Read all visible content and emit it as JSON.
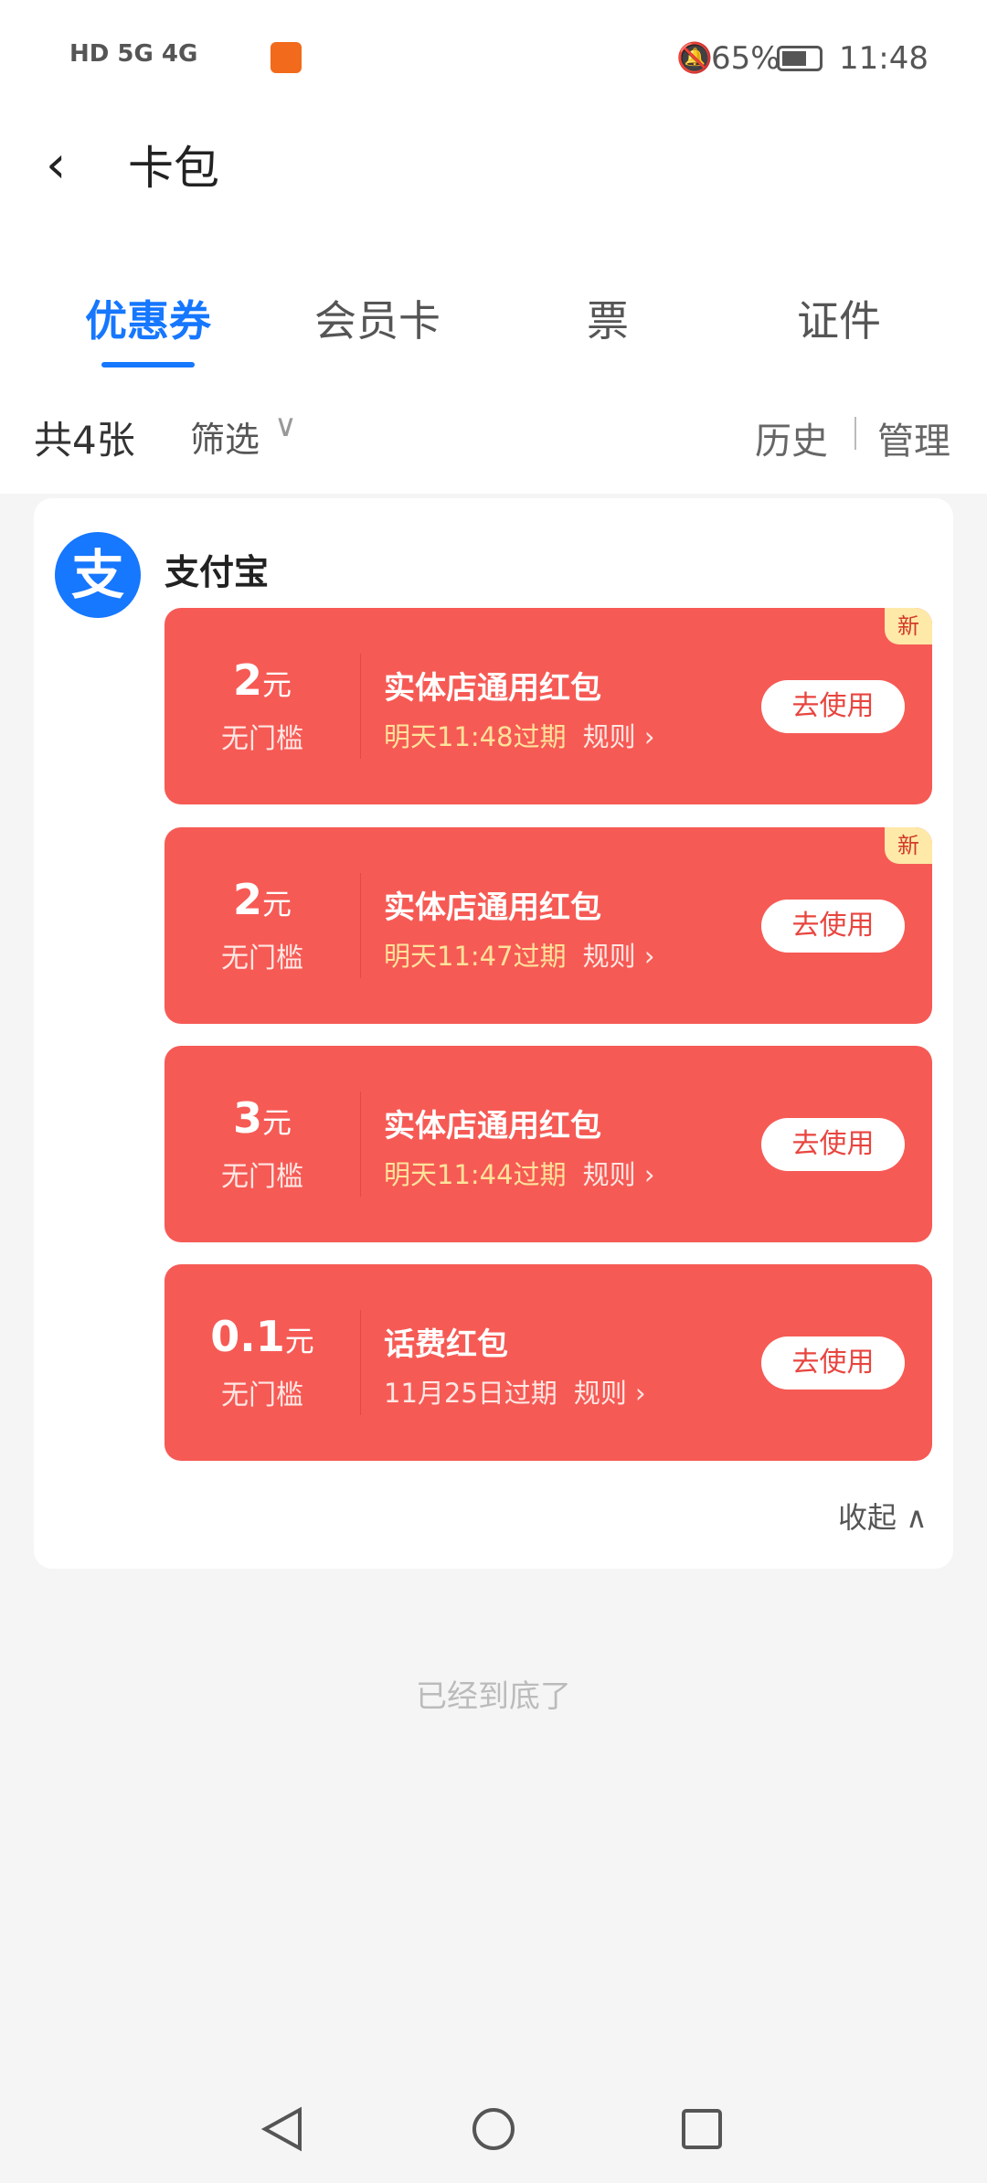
{
  "status": {
    "left": "HD 5G 4G",
    "battery": "65%",
    "time": "11:48"
  },
  "header": {
    "title": "卡包"
  },
  "tabs": [
    {
      "label": "优惠券"
    },
    {
      "label": "会员卡"
    },
    {
      "label": "票"
    },
    {
      "label": "证件"
    }
  ],
  "filter": {
    "count": "共4张",
    "filter": "筛选",
    "history": "历史",
    "manage": "管理"
  },
  "group": {
    "name": "支付宝",
    "logo": "支",
    "collapse": "收起"
  },
  "coupons": [
    {
      "amount": "2",
      "unit": "元",
      "threshold": "无门槛",
      "title": "实体店通用红包",
      "expiry": "明天11:48过期",
      "rule": "规则",
      "button": "去使用",
      "badge": "新"
    },
    {
      "amount": "2",
      "unit": "元",
      "threshold": "无门槛",
      "title": "实体店通用红包",
      "expiry": "明天11:47过期",
      "rule": "规则",
      "button": "去使用",
      "badge": "新"
    },
    {
      "amount": "3",
      "unit": "元",
      "threshold": "无门槛",
      "title": "实体店通用红包",
      "expiry": "明天11:44过期",
      "rule": "规则",
      "button": "去使用"
    },
    {
      "amount": "0.1",
      "unit": "元",
      "threshold": "无门槛",
      "title": "话费红包",
      "expiry": "11月25日过期",
      "rule": "规则",
      "button": "去使用"
    }
  ],
  "footer": {
    "end": "已经到底了"
  },
  "colors": {
    "accent": "#1677ff",
    "coupon": "#f65a55",
    "expiry": "#ffe29a"
  }
}
